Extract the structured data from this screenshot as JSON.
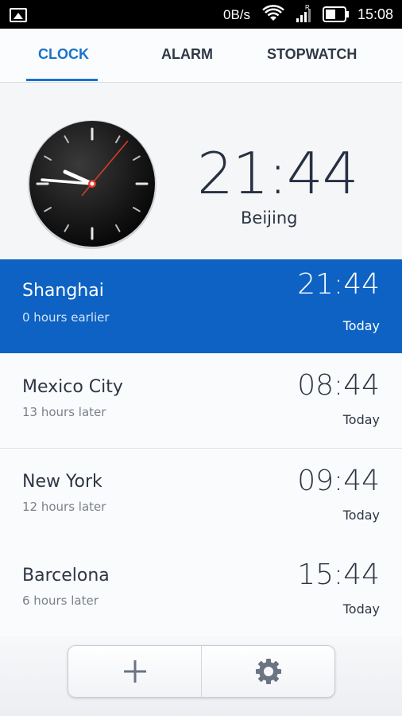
{
  "statusbar": {
    "speed": "0B/s",
    "time": "15:08",
    "signal_badge": "R"
  },
  "tabs": [
    {
      "label": "CLOCK",
      "active": true
    },
    {
      "label": "ALARM",
      "active": false
    },
    {
      "label": "STOPWATCH",
      "active": false
    }
  ],
  "main_clock": {
    "time": "21:44",
    "city": "Beijing"
  },
  "world_clocks": [
    {
      "city": "Shanghai",
      "offset": "0 hours earlier",
      "time": "21:44",
      "day": "Today",
      "selected": true
    },
    {
      "city": "Mexico City",
      "offset": "13 hours later",
      "time": "08:44",
      "day": "Today",
      "selected": false
    },
    {
      "city": "New York",
      "offset": "12 hours later",
      "time": "09:44",
      "day": "Today",
      "selected": false
    },
    {
      "city": "Barcelona",
      "offset": "6 hours later",
      "time": "15:44",
      "day": "Today",
      "selected": false
    }
  ],
  "actions": {
    "add_icon": "plus-icon",
    "settings_icon": "gear-icon"
  },
  "colors": {
    "accent": "#1a73c9",
    "selected_row": "#0d62c3"
  }
}
